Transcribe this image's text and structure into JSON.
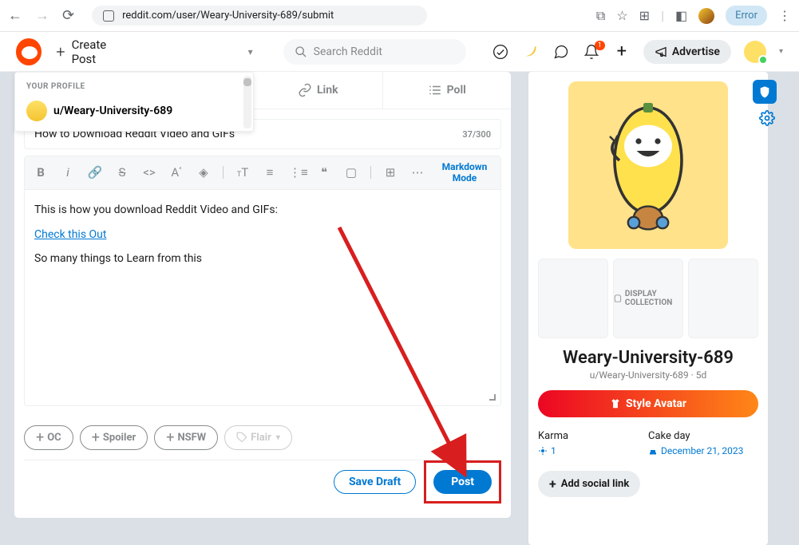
{
  "browser": {
    "url": "reddit.com/user/Weary-University-689/submit",
    "error_badge": "Error"
  },
  "header": {
    "create_post": "Create Post",
    "search_placeholder": "Search Reddit",
    "advertise": "Advertise",
    "notif_count": "1"
  },
  "community_dropdown": {
    "section_label": "YOUR PROFILE",
    "items": [
      {
        "label": "u/Weary-University-689"
      }
    ]
  },
  "post_tabs": {
    "link": "Link",
    "poll": "Poll"
  },
  "title_field": {
    "value": "How to Download Reddit Video and GIFs",
    "counter": "37/300"
  },
  "editor": {
    "markdown_toggle": "Markdown Mode",
    "body_line1": "This is how you download Reddit Video and GIFs:",
    "body_link": "Check this Out",
    "body_line3": "So many things to Learn from this"
  },
  "flairs": {
    "oc": "OC",
    "spoiler": "Spoiler",
    "nsfw": "NSFW",
    "flair": "Flair"
  },
  "actions": {
    "save_draft": "Save Draft",
    "post": "Post"
  },
  "sidebar": {
    "display_collection": "DISPLAY COLLECTION",
    "username_display": "Weary-University-689",
    "username_handle": "u/Weary-University-689 · 5d",
    "style_avatar": "Style Avatar",
    "karma_label": "Karma",
    "karma_value": "1",
    "cakeday_label": "Cake day",
    "cakeday_value": "December 21, 2023",
    "add_social": "Add social link"
  }
}
